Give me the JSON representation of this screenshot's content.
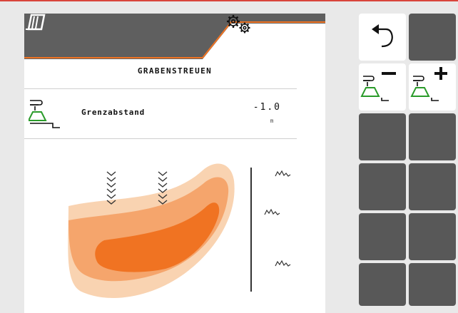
{
  "header": {
    "home_icon": "field-home-icon",
    "settings_icon": "gears-icon",
    "accent_color": "#f07322",
    "bar_color": "#5f5f5f"
  },
  "screen": {
    "title": "GRABENSTREUEN"
  },
  "parameter": {
    "icon": "border-distance-icon",
    "label": "Grenzabstand",
    "value": "-1.0",
    "unit": "m"
  },
  "illustration": {
    "description_icons": [
      "tramline-chevrons-icon",
      "grass-border-icon",
      "border-line-icon"
    ],
    "colors": [
      "#f9d3b1",
      "#f5a56c",
      "#f07322"
    ]
  },
  "softkeys": [
    {
      "name": "back-button",
      "icon": "back-arrow-icon",
      "style": "light"
    },
    {
      "name": "softkey-blank-1",
      "icon": "",
      "style": "dark"
    },
    {
      "name": "decrease-distance-button",
      "icon": "spreader-minus-icon",
      "style": "light"
    },
    {
      "name": "increase-distance-button",
      "icon": "spreader-plus-icon",
      "style": "light"
    },
    {
      "name": "softkey-blank-2",
      "icon": "",
      "style": "dark"
    },
    {
      "name": "softkey-blank-3",
      "icon": "",
      "style": "dark"
    },
    {
      "name": "softkey-blank-4",
      "icon": "",
      "style": "dark"
    },
    {
      "name": "softkey-blank-5",
      "icon": "",
      "style": "dark"
    },
    {
      "name": "softkey-blank-6",
      "icon": "",
      "style": "dark"
    },
    {
      "name": "softkey-blank-7",
      "icon": "",
      "style": "dark"
    },
    {
      "name": "softkey-blank-8",
      "icon": "",
      "style": "dark"
    },
    {
      "name": "softkey-blank-9",
      "icon": "",
      "style": "dark"
    }
  ]
}
